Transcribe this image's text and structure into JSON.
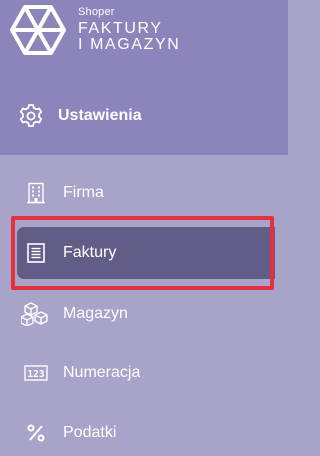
{
  "brand": {
    "small": "Shoper",
    "line1": "FAKTURY",
    "line2": "I MAGAZYN"
  },
  "header": {
    "title": "Ustawienia",
    "icon": "gear-icon"
  },
  "menu": {
    "items": [
      {
        "label": "Firma",
        "icon": "building-icon"
      },
      {
        "label": "Faktury",
        "icon": "invoice-icon",
        "active": true
      },
      {
        "label": "Magazyn",
        "icon": "boxes-icon"
      },
      {
        "label": "Numeracja",
        "icon": "numbering-icon"
      },
      {
        "label": "Podatki",
        "icon": "percent-icon"
      }
    ]
  },
  "colors": {
    "header_bg": "#8a85ba",
    "menu_bg": "#a7a3c9",
    "active_bg": "#625d86",
    "highlight": "#e5303d",
    "text": "#ffffff"
  }
}
